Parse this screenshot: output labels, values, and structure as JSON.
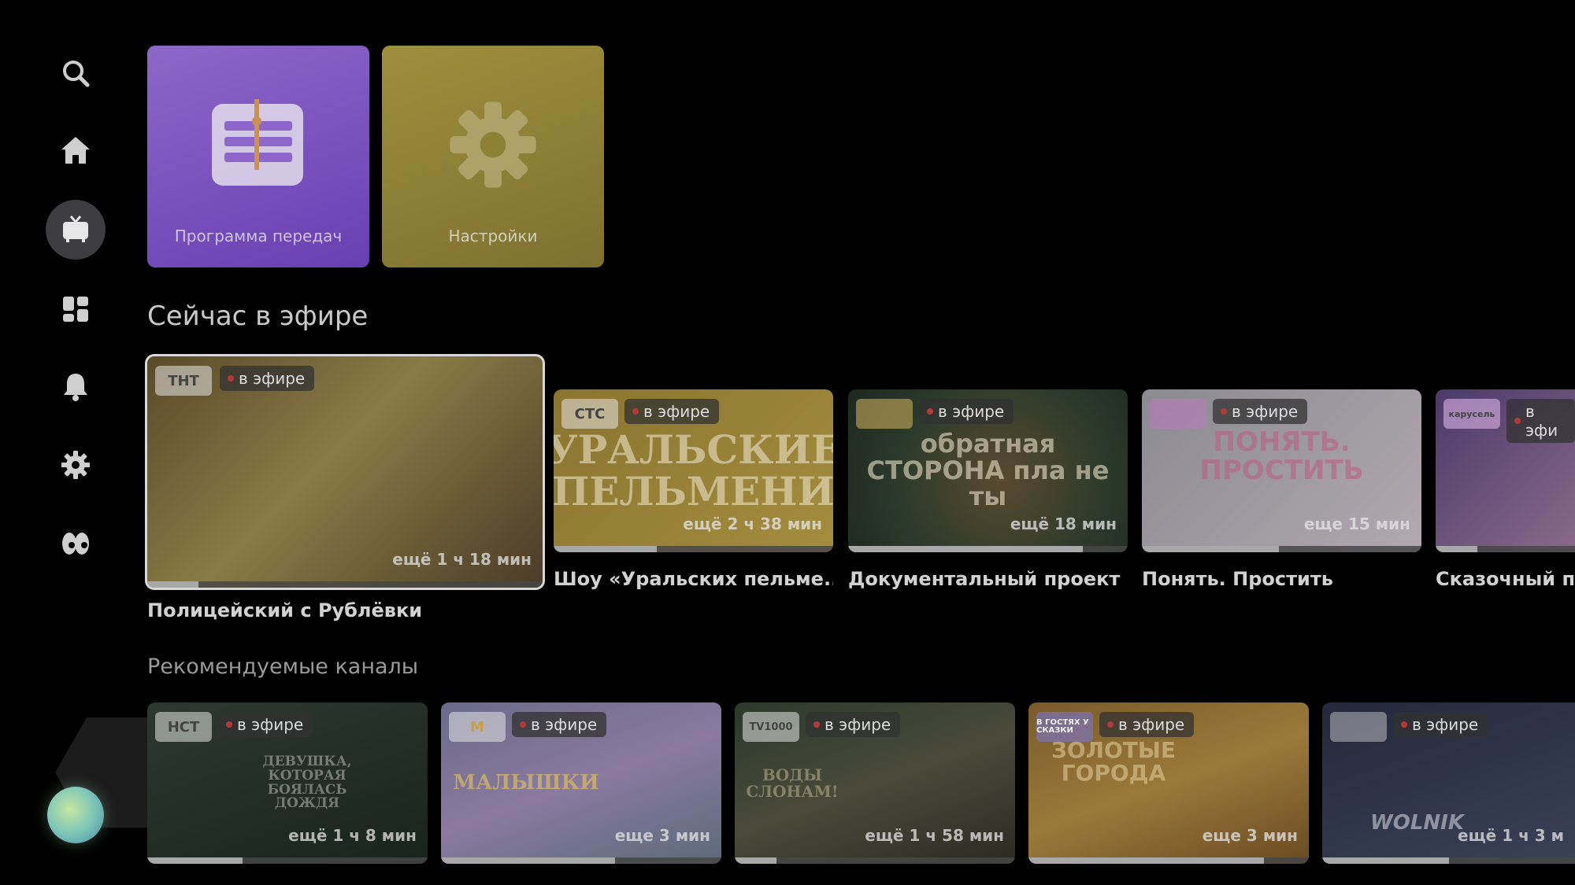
{
  "sidebar": {
    "items": [
      {
        "icon": "search-icon"
      },
      {
        "icon": "home-icon"
      },
      {
        "icon": "tv-icon",
        "active": true
      },
      {
        "icon": "apps-grid-icon"
      },
      {
        "icon": "bell-icon"
      },
      {
        "icon": "gear-icon"
      },
      {
        "icon": "kids-eyes-icon"
      }
    ]
  },
  "quick_tiles": [
    {
      "label": "Программа передач",
      "color": "#7b52bd",
      "icon": "tv-guide-icon"
    },
    {
      "label": "Настройки",
      "color": "#8e8035",
      "icon": "gear-icon"
    }
  ],
  "now_on_air": {
    "title": "Сейчас в эфире",
    "cards": [
      {
        "logo": "ТНТ",
        "live": "в эфире",
        "remaining": "ещё 1 ч 18 мин",
        "progress": 0.13,
        "title": "Полицейский с Рублёвки",
        "art": ""
      },
      {
        "logo": "СТС",
        "live": "в эфире",
        "remaining": "ещё 2 ч 38 мин",
        "progress": 0.37,
        "title": "Шоу «Уральских пельме...",
        "art": "УРАЛЬСКИЕ ПЕЛЬМЕНИ"
      },
      {
        "logo": "",
        "live": "в эфире",
        "remaining": "ещё 18 мин",
        "progress": 0.84,
        "title": "Документальный проект",
        "art": "обратная СТОРОНА пла не ты"
      },
      {
        "logo": "",
        "live": "в эфире",
        "remaining": "еще 15 мин",
        "progress": 0.49,
        "title": "Понять. Простить",
        "art": "ПОНЯТЬ. ПРОСТИТЬ"
      },
      {
        "logo": "карусель",
        "live": "в эфи",
        "remaining": "",
        "progress": 0.3,
        "title": "Сказочный па",
        "art": ""
      }
    ]
  },
  "recommended": {
    "title": "Рекомендуемые каналы",
    "cards": [
      {
        "logo": "НСТ",
        "live": "в эфире",
        "remaining": "ещё 1 ч 8 мин",
        "progress": 0.34,
        "art": "ДЕВУШКА, КОТОРАЯ БОЯЛАСЬ ДОЖДЯ"
      },
      {
        "logo": "М",
        "live": "в эфире",
        "remaining": "еще 3 мин",
        "progress": 0.62,
        "art": "МАЛЫШКИ"
      },
      {
        "logo": "TV1000",
        "live": "в эфире",
        "remaining": "ещё 1 ч 58 мин",
        "progress": 0.15,
        "art": "ВОДЫ СЛОНАМ!"
      },
      {
        "logo": "В ГОСТЯХ У СКАЗКИ",
        "live": "в эфире",
        "remaining": "еще 3 мин",
        "progress": 0.84,
        "art": "ЗОЛОТЫЕ ГОРОДА"
      },
      {
        "logo": "",
        "live": "в эфире",
        "remaining": "ещё 1 ч 3 м",
        "progress": 0.5,
        "art": "WOLNIK"
      }
    ]
  }
}
